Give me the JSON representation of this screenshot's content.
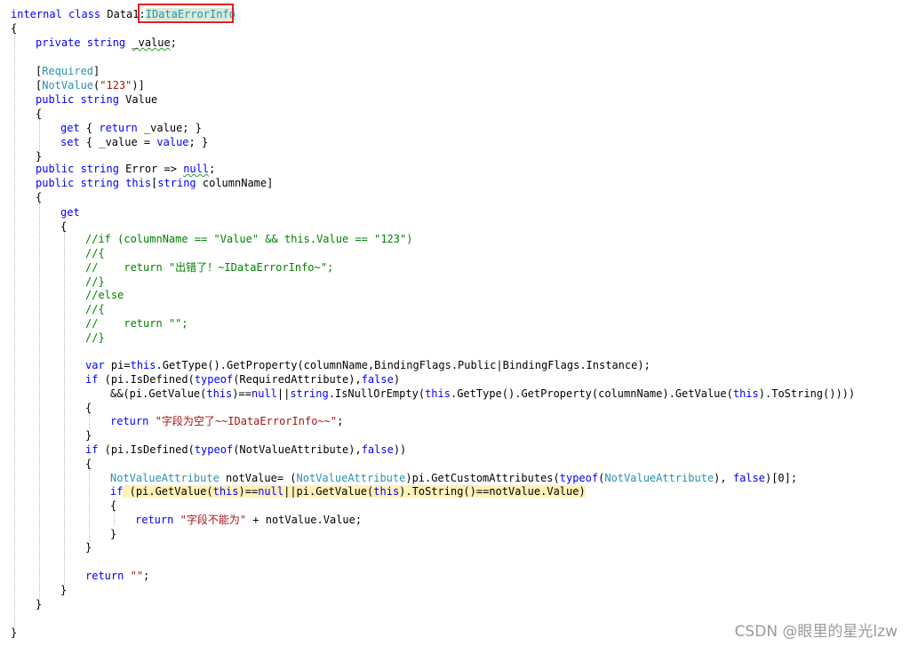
{
  "lines": [
    [
      [
        "internal class ",
        "keyword"
      ],
      [
        "Data1",
        "plain"
      ],
      [
        ":",
        "plain"
      ],
      [
        "IDataErrorInfo",
        "type"
      ]
    ],
    [
      [
        "{",
        "plain"
      ]
    ],
    [
      [
        "private string ",
        "keyword"
      ],
      [
        "_value",
        "plain"
      ],
      [
        ";",
        "plain"
      ]
    ],
    [],
    [
      [
        "[",
        "plain"
      ],
      [
        "Required",
        "attr"
      ],
      [
        "]",
        "plain"
      ]
    ],
    [
      [
        "[",
        "plain"
      ],
      [
        "NotValue",
        "attr"
      ],
      [
        "(",
        "plain"
      ],
      [
        "\"123\"",
        "string"
      ],
      [
        ")]",
        "plain"
      ]
    ],
    [
      [
        "public string ",
        "keyword"
      ],
      [
        "Value",
        "plain"
      ]
    ],
    [
      [
        "{",
        "plain"
      ]
    ],
    [
      [
        "get",
        "keyword"
      ],
      [
        " { ",
        "plain"
      ],
      [
        "return",
        "keyword"
      ],
      [
        " _value; }",
        "plain"
      ]
    ],
    [
      [
        "set",
        "keyword"
      ],
      [
        " { _value = ",
        "plain"
      ],
      [
        "value",
        "keyword"
      ],
      [
        "; }",
        "plain"
      ]
    ],
    [
      [
        "}",
        "plain"
      ]
    ],
    [
      [
        "public string ",
        "keyword"
      ],
      [
        "Error => ",
        "plain"
      ],
      [
        "null",
        "keyword"
      ],
      [
        ";",
        "plain"
      ]
    ],
    [
      [
        "public string ",
        "keyword"
      ],
      [
        "this",
        "keyword"
      ],
      [
        "[",
        "plain"
      ],
      [
        "string",
        "keyword"
      ],
      [
        " columnName]",
        "plain"
      ]
    ],
    [
      [
        "{",
        "plain"
      ]
    ],
    [
      [
        "get",
        "keyword"
      ]
    ],
    [
      [
        "{",
        "plain"
      ]
    ],
    [
      [
        "//if (columnName == \"Value\" && this.Value == \"123\")",
        "comment"
      ]
    ],
    [
      [
        "//{",
        "comment"
      ]
    ],
    [
      [
        "//    return \"出错了！~IDataErrorInfo~\";",
        "comment"
      ]
    ],
    [
      [
        "//}",
        "comment"
      ]
    ],
    [
      [
        "//else",
        "comment"
      ]
    ],
    [
      [
        "//{",
        "comment"
      ]
    ],
    [
      [
        "//    return \"\";",
        "comment"
      ]
    ],
    [
      [
        "//}",
        "comment"
      ]
    ],
    [],
    [
      [
        "var",
        "keyword"
      ],
      [
        " pi=",
        "plain"
      ],
      [
        "this",
        "keyword"
      ],
      [
        ".GetType().GetProperty(columnName,BindingFlags.Public|BindingFlags.Instance);",
        "plain"
      ]
    ],
    [
      [
        "if",
        "keyword"
      ],
      [
        " (pi.IsDefined(",
        "plain"
      ],
      [
        "typeof",
        "keyword"
      ],
      [
        "(RequiredAttribute),",
        "plain"
      ],
      [
        "false",
        "keyword"
      ],
      [
        ")",
        "plain"
      ]
    ],
    [
      [
        "&&(pi.GetValue(",
        "plain"
      ],
      [
        "this",
        "keyword"
      ],
      [
        ")==",
        "plain"
      ],
      [
        "null",
        "keyword"
      ],
      [
        "||",
        "plain"
      ],
      [
        "string",
        "keyword"
      ],
      [
        ".IsNullOrEmpty(",
        "plain"
      ],
      [
        "this",
        "keyword"
      ],
      [
        ".GetType().GetProperty(columnName).GetValue(",
        "plain"
      ],
      [
        "this",
        "keyword"
      ],
      [
        ").ToString())))",
        "plain"
      ]
    ],
    [
      [
        "{",
        "plain"
      ]
    ],
    [
      [
        "return",
        "keyword"
      ],
      [
        " ",
        "plain"
      ],
      [
        "\"字段为空了~~IDataErrorInfo~~\"",
        "string"
      ],
      [
        ";",
        "plain"
      ]
    ],
    [
      [
        "}",
        "plain"
      ]
    ],
    [
      [
        "if",
        "keyword"
      ],
      [
        " (pi.IsDefined(",
        "plain"
      ],
      [
        "typeof",
        "keyword"
      ],
      [
        "(NotValueAttribute),",
        "plain"
      ],
      [
        "false",
        "keyword"
      ],
      [
        "))",
        "plain"
      ]
    ],
    [
      [
        "{",
        "plain"
      ]
    ],
    [
      [
        "NotValueAttribute",
        "type"
      ],
      [
        " notValue= (",
        "plain"
      ],
      [
        "NotValueAttribute",
        "type"
      ],
      [
        ")pi.GetCustomAttributes(",
        "plain"
      ],
      [
        "typeof",
        "keyword"
      ],
      [
        "(",
        "plain"
      ],
      [
        "NotValueAttribute",
        "type"
      ],
      [
        "), ",
        "plain"
      ],
      [
        "false",
        "keyword"
      ],
      [
        ")[0];",
        "plain"
      ]
    ],
    [
      [
        "if",
        "keyword"
      ],
      [
        " (pi.GetValue(",
        "plain"
      ],
      [
        "this",
        "keyword"
      ],
      [
        ")==",
        "plain"
      ],
      [
        "null",
        "keyword"
      ],
      [
        "||pi.GetValue(",
        "plain"
      ],
      [
        "this",
        "keyword"
      ],
      [
        ").ToString()==notValue.Value)",
        "plain"
      ]
    ],
    [
      [
        "{",
        "plain"
      ]
    ],
    [
      [
        "return",
        "keyword"
      ],
      [
        " ",
        "plain"
      ],
      [
        "\"字段不能为\"",
        "string"
      ],
      [
        " + notValue.Value;",
        "plain"
      ]
    ],
    [
      [
        "}",
        "plain"
      ]
    ],
    [
      [
        "}",
        "plain"
      ]
    ],
    [],
    [
      [
        "return",
        "keyword"
      ],
      [
        " ",
        "plain"
      ],
      [
        "\"\"",
        "string"
      ],
      [
        ";",
        "plain"
      ]
    ],
    [
      [
        "}",
        "plain"
      ]
    ],
    [
      [
        "}",
        "plain"
      ]
    ],
    [],
    [
      [
        "}",
        "plain"
      ]
    ]
  ],
  "watermark": "CSDN @眼里的星光lzw"
}
